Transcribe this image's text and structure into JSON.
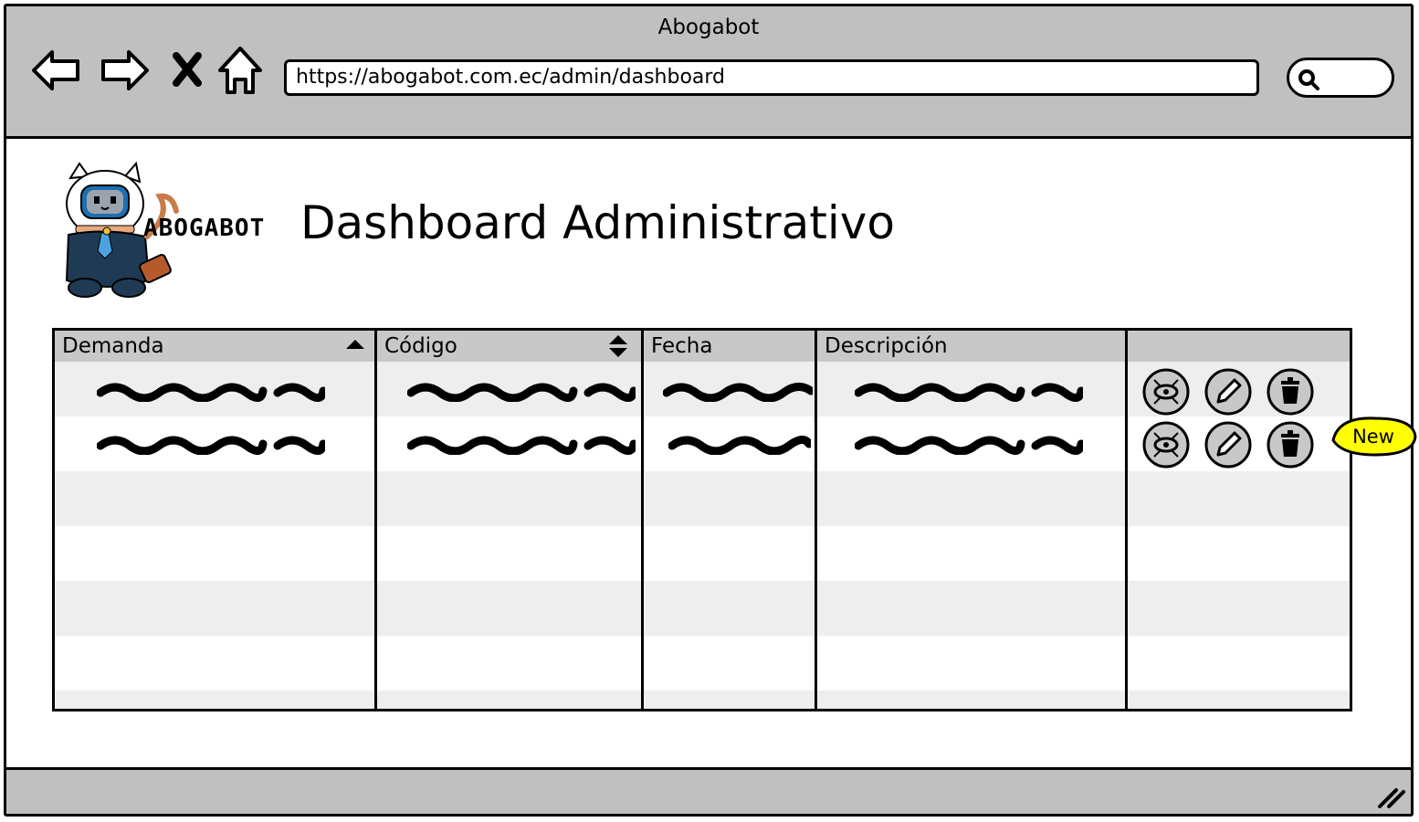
{
  "window": {
    "title": "Abogabot"
  },
  "browser": {
    "url": "https://abogabot.com.ec/admin/dashboard",
    "nav": [
      "back-icon",
      "forward-icon",
      "close-icon",
      "home-icon"
    ],
    "search_icon": "search-icon"
  },
  "header": {
    "logo_text": "ABOGABOT",
    "title": "Dashboard Administrativo"
  },
  "table": {
    "columns": [
      {
        "label": "Demanda",
        "sort": "asc"
      },
      {
        "label": "Código",
        "sort": "both"
      },
      {
        "label": "Fecha",
        "sort": "none"
      },
      {
        "label": "Descripción",
        "sort": "none"
      },
      {
        "label": "",
        "sort": "none"
      }
    ],
    "rows": [
      {
        "actions": [
          "view-icon",
          "edit-icon",
          "trash-icon"
        ]
      },
      {
        "actions": [
          "view-icon",
          "edit-icon",
          "trash-icon"
        ]
      }
    ],
    "empty_rows": 4
  },
  "badge": {
    "label": "New",
    "color": "#ffff00"
  },
  "colors": {
    "chrome": "#c0c0c0",
    "header": "#c8c8c8",
    "stripe": "#eeeeee"
  }
}
